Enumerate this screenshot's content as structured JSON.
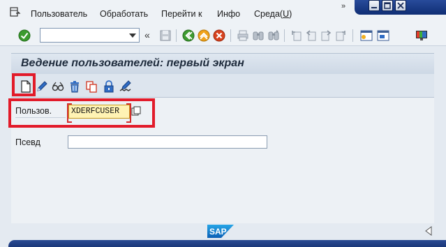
{
  "menu": {
    "items": [
      {
        "label": "Пользователь"
      },
      {
        "label": "Обработать"
      },
      {
        "label": "Перейти к"
      },
      {
        "label": "Инфо"
      },
      {
        "label_main": "Среда(",
        "label_key": "U",
        "label_end": ")"
      }
    ],
    "more": "»"
  },
  "toolbar": {
    "command_field_value": "",
    "chevron": "«",
    "icons": [
      "enter-check-icon",
      "save-icon",
      "back-icon",
      "exit-icon",
      "cancel-icon",
      "print-icon",
      "find-icon",
      "find-next-icon",
      "first-page-icon",
      "prev-page-icon",
      "next-page-icon",
      "last-page-icon",
      "create-session-icon",
      "shortcut-icon",
      "customize-layout-icon"
    ]
  },
  "page": {
    "title": "Ведение пользователей: первый экран"
  },
  "app_toolbar": {
    "icons": [
      "create-icon",
      "change-pencil-icon",
      "display-glasses-icon",
      "delete-trash-icon",
      "copy-icon",
      "lock-icon",
      "change-password-icon"
    ]
  },
  "form": {
    "user_label": "Пользов.",
    "user_value": "XDERFCUSER",
    "alias_label": "Псевд",
    "alias_value": ""
  },
  "footer": {
    "logo_text": "SAP"
  },
  "colors": {
    "highlight": "#e21b2a",
    "field_required_bg": "#fff3b4",
    "title_bg": "#d6dfea",
    "status_bar": "#1e3c80"
  }
}
